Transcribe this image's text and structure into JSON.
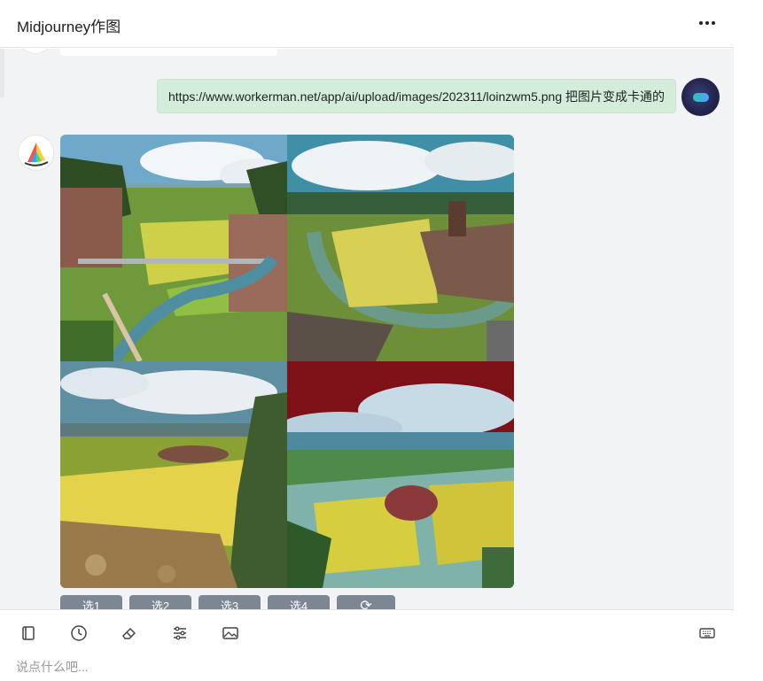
{
  "header": {
    "title": "Midjourney作图"
  },
  "messages": {
    "user_prompt": "https://www.workerman.net/app/ai/upload/images/202311/loinzwm5.png 把图片变成卡通的"
  },
  "image_grid": {
    "tiles": [
      "village-river-valley",
      "rice-field-river-bend",
      "yellow-plain-cliff",
      "red-sky-terraces"
    ]
  },
  "actions": {
    "buttons": [
      "选1",
      "选2",
      "选3",
      "选4"
    ],
    "refresh_icon": "refresh-icon"
  },
  "toolbar": {
    "icons": [
      "book-icon",
      "clock-icon",
      "eraser-icon",
      "sliders-icon",
      "image-icon",
      "keyboard-icon"
    ],
    "input_placeholder": "说点什么吧..."
  },
  "colors": {
    "user_bubble": "#d4edda",
    "chat_bg": "#f2f3f5",
    "action_button": "#7d8794"
  }
}
